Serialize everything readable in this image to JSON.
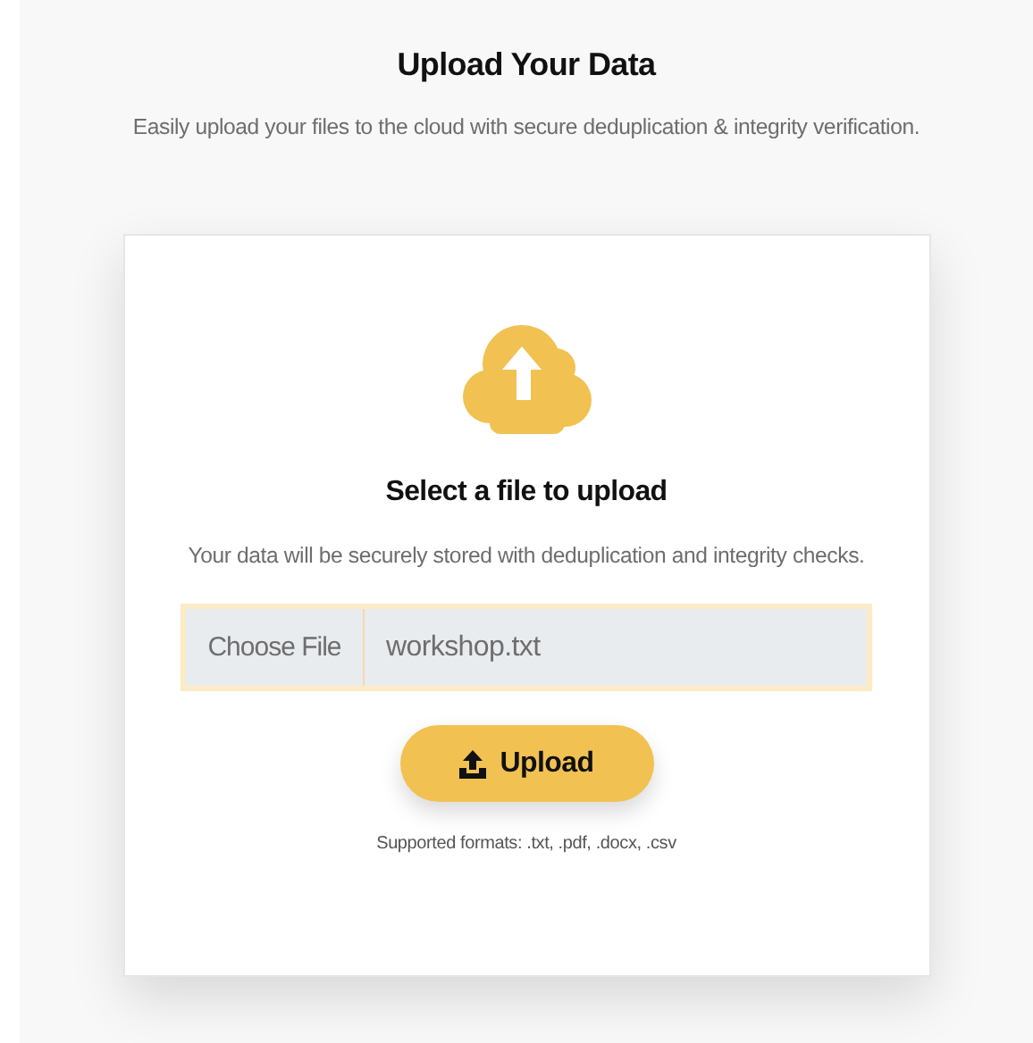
{
  "header": {
    "title": "Upload Your Data",
    "subtitle": "Easily upload your files to the cloud with secure deduplication & integrity verification."
  },
  "card": {
    "heading": "Select a file to upload",
    "description": "Your data will be securely stored with deduplication and integrity checks.",
    "file_input": {
      "button_label": "Choose File",
      "value": "workshop.txt"
    },
    "upload_button": {
      "label": "Upload"
    },
    "note": "Supported formats: .txt, .pdf, .docx, .csv"
  }
}
